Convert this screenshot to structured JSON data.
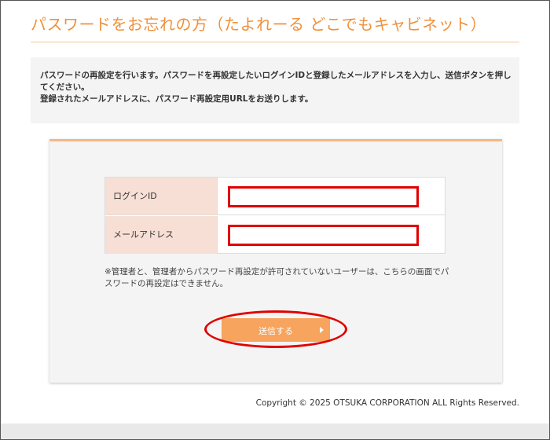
{
  "header": {
    "title": "パスワードをお忘れの方（たよれーる どこでもキャビネット）"
  },
  "notice": {
    "line1": "パスワードの再設定を行います。パスワードを再設定したいログインIDと登録したメールアドレスを入力し、送信ボタンを押してください。",
    "line2": "登録されたメールアドレスに、パスワード再設定用URLをお送りします。"
  },
  "form": {
    "login_id_label": "ログインID",
    "login_id_value": "",
    "email_label": "メールアドレス",
    "email_value": "",
    "caution": "※管理者と、管理者からパスワード再設定が許可されていないユーザーは、こちらの画面でパスワードの再設定はできません。",
    "submit_label": "送信する"
  },
  "footer": {
    "copyright": "Copyright © 2025 OTSUKA CORPORATION ALL Rights Reserved."
  },
  "colors": {
    "accent": "#f0903a",
    "button": "#f6a45e",
    "label_bg": "#f7dfd5",
    "highlight": "#e00000"
  }
}
